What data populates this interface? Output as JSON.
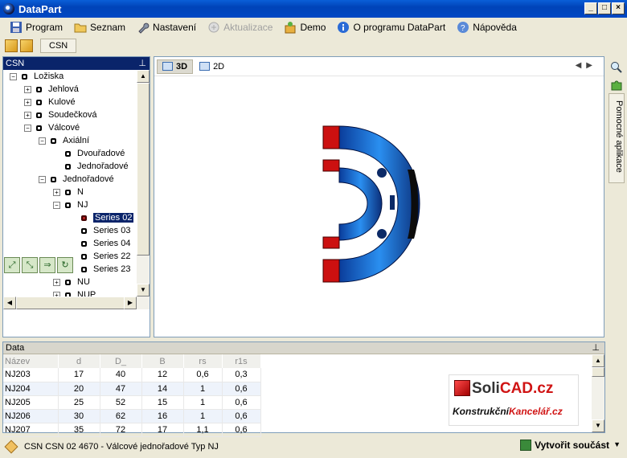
{
  "window": {
    "title": "DataPart",
    "min": "_",
    "max": "□",
    "close": "×"
  },
  "menu": [
    {
      "label": "Program",
      "icon": "save-icon",
      "disabled": false
    },
    {
      "label": "Seznam",
      "icon": "folder-icon",
      "disabled": false
    },
    {
      "label": "Nastavení",
      "icon": "wrench-icon",
      "disabled": false
    },
    {
      "label": "Aktualizace",
      "icon": "update-icon",
      "disabled": true
    },
    {
      "label": "Demo",
      "icon": "demo-icon",
      "disabled": false
    },
    {
      "label": "O programu DataPart",
      "icon": "info-icon",
      "disabled": false
    },
    {
      "label": "Nápověda",
      "icon": "help-icon",
      "disabled": false
    }
  ],
  "toolbar": {
    "tab_label": "CSN"
  },
  "tree_panel": {
    "title": "CSN",
    "pin": "📌",
    "nodes": [
      {
        "label": "Ložiska",
        "level": 0,
        "expander": "−"
      },
      {
        "label": "Jehlová",
        "level": 1,
        "expander": "+"
      },
      {
        "label": "Kulové",
        "level": 1,
        "expander": "+"
      },
      {
        "label": "Soudečková",
        "level": 1,
        "expander": "+"
      },
      {
        "label": "Válcové",
        "level": 1,
        "expander": "−"
      },
      {
        "label": "Axiální",
        "level": 2,
        "expander": "−"
      },
      {
        "label": "Dvouřadové",
        "level": 3,
        "expander": ""
      },
      {
        "label": "Jednořadové",
        "level": 3,
        "expander": ""
      },
      {
        "label": "Jednořadové",
        "level": 2,
        "expander": "−"
      },
      {
        "label": "N",
        "level": 3,
        "expander": "+"
      },
      {
        "label": "NJ",
        "level": 3,
        "expander": "−"
      },
      {
        "label": "Series 02",
        "level": 4,
        "expander": "",
        "selected": true
      },
      {
        "label": "Series 03",
        "level": 4,
        "expander": ""
      },
      {
        "label": "Series 04",
        "level": 4,
        "expander": ""
      },
      {
        "label": "Series 22",
        "level": 4,
        "expander": ""
      },
      {
        "label": "Series 23",
        "level": 4,
        "expander": ""
      },
      {
        "label": "NU",
        "level": 3,
        "expander": "+"
      },
      {
        "label": "NUP",
        "level": 3,
        "expander": "+"
      }
    ]
  },
  "viewer": {
    "tabs": [
      {
        "label": "3D",
        "active": true
      },
      {
        "label": "2D",
        "active": false
      }
    ]
  },
  "side_panel": {
    "label": "Pomocné aplikace"
  },
  "data_panel": {
    "title": "Data",
    "columns": [
      "Název",
      "d",
      "D_",
      "B",
      "rs",
      "r1s"
    ],
    "rows": [
      [
        "NJ203",
        "17",
        "40",
        "12",
        "0,6",
        "0,3"
      ],
      [
        "NJ204",
        "20",
        "47",
        "14",
        "1",
        "0,6"
      ],
      [
        "NJ205",
        "25",
        "52",
        "15",
        "1",
        "0,6"
      ],
      [
        "NJ206",
        "30",
        "62",
        "16",
        "1",
        "0,6"
      ],
      [
        "NJ207",
        "35",
        "72",
        "17",
        "1,1",
        "0,6"
      ]
    ],
    "logo": {
      "line1_a": "Soli",
      "line1_b": "CAD.cz",
      "line2_a": "Konstrukční",
      "line2_b": "Kancelář.cz"
    }
  },
  "status": {
    "text": "CSN CSN 02 4670 - Válcové jednořadové Typ NJ",
    "create_button": "Vytvořit součást"
  }
}
